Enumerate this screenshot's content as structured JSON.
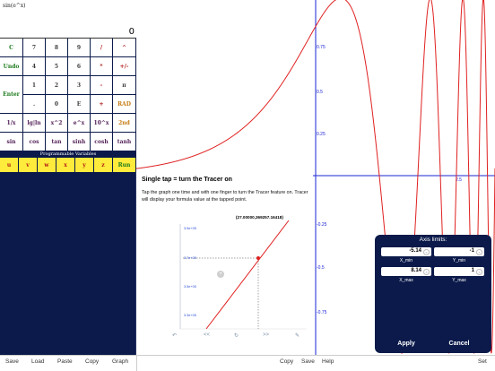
{
  "display": {
    "expression": "sin(e^x)",
    "result": "0"
  },
  "keypad": {
    "rows": [
      [
        {
          "label": "C",
          "color": "green"
        },
        {
          "label": "7",
          "color": "dark"
        },
        {
          "label": "8",
          "color": "dark"
        },
        {
          "label": "9",
          "color": "dark"
        },
        {
          "label": "/",
          "color": "red"
        },
        {
          "label": "^",
          "color": "red"
        }
      ],
      [
        {
          "label": "Undo",
          "color": "green"
        },
        {
          "label": "4",
          "color": "dark"
        },
        {
          "label": "5",
          "color": "dark"
        },
        {
          "label": "6",
          "color": "dark"
        },
        {
          "label": "*",
          "color": "red"
        },
        {
          "label": "+/-",
          "color": "red"
        }
      ],
      [
        {
          "label": "Enter",
          "color": "green"
        },
        {
          "label": "1",
          "color": "dark"
        },
        {
          "label": "2",
          "color": "dark"
        },
        {
          "label": "3",
          "color": "dark"
        },
        {
          "label": "-",
          "color": "red"
        },
        {
          "label": "π",
          "color": "dark"
        }
      ],
      [
        {
          "label": "",
          "color": "dark"
        },
        {
          "label": ".",
          "color": "dark"
        },
        {
          "label": "0",
          "color": "dark"
        },
        {
          "label": "E",
          "color": "dark"
        },
        {
          "label": "+",
          "color": "red"
        },
        {
          "label": "RAD",
          "color": "orange"
        }
      ],
      [
        {
          "label": "1/x",
          "color": "purple"
        },
        {
          "label": "lg|ln",
          "color": "purple"
        },
        {
          "label": "x^2",
          "color": "purple"
        },
        {
          "label": "e^x",
          "color": "purple"
        },
        {
          "label": "10^x",
          "color": "purple"
        },
        {
          "label": "2nd",
          "color": "orange"
        }
      ],
      [
        {
          "label": "sin",
          "color": "purple"
        },
        {
          "label": "cos",
          "color": "purple"
        },
        {
          "label": "tan",
          "color": "purple"
        },
        {
          "label": "sinh",
          "color": "purple"
        },
        {
          "label": "cosh",
          "color": "purple"
        },
        {
          "label": "tanh",
          "color": "purple"
        }
      ]
    ],
    "programmable_label": "Programmable Variables",
    "variables": [
      "u",
      "v",
      "w",
      "x",
      "y",
      "z",
      "Run"
    ]
  },
  "graph": {
    "function": "sin(e^x)",
    "x_axis_label": "2.5",
    "y_tick_labels": [
      "0.75",
      "0.5",
      "0.25",
      "-0.25",
      "-0.5",
      "-0.75"
    ],
    "curve_color": "#e02020",
    "axis_color": "#1b24d6"
  },
  "help": {
    "title": "Single tap = turn the Tracer on",
    "body": "Tap the graph one time and with one finger to turn the Tracer feature on. Tracer will display your formula value at the tapped point.",
    "coordinate": "(27.00000,369257.16418)",
    "y_ticks": [
      "3.9e+05",
      "3.7e+05",
      "3.5e+05",
      "3.3e+05"
    ],
    "nav": [
      "↶",
      "<<",
      "↻",
      ">>",
      "✎"
    ]
  },
  "axis_dialog": {
    "title": "Axis limits:",
    "x_min": {
      "label": "X_min",
      "value": "-5.14"
    },
    "y_min": {
      "label": "Y_min",
      "value": "-1"
    },
    "x_max": {
      "label": "X_max",
      "value": "8.14"
    },
    "y_max": {
      "label": "Y_max",
      "value": "1"
    },
    "apply": "Apply",
    "cancel": "Cancel"
  },
  "toolbar": {
    "left": [
      "Save",
      "Load",
      "Paste",
      "Copy",
      "Graph"
    ],
    "right": [
      "Copy",
      "Save",
      "Help"
    ],
    "set": "Set"
  }
}
